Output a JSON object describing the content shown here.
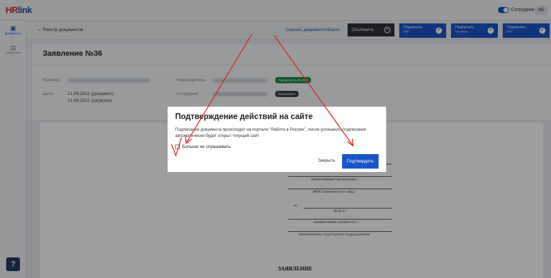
{
  "header": {
    "logo_prefix": "HR",
    "logo_suffix": "link",
    "role_label": "Сотрудник",
    "avatar_initials": "ВЕ"
  },
  "sidebar": {
    "items": [
      {
        "label": "Документы",
        "icon": "documents-icon"
      },
      {
        "label": "Заявления",
        "icon": "file-icon"
      }
    ],
    "help_label": "?"
  },
  "toolbar": {
    "back_label": "← Реестр документов",
    "download_label": "Скачать документооборот",
    "reject_label": "Отклонить",
    "sign_buttons": [
      {
        "title": "Подписать",
        "subtitle": "SMS"
      },
      {
        "title": "Подписать",
        "subtitle": "Госуслуги"
      },
      {
        "title": "Подписать",
        "subtitle": "КЭП"
      }
    ]
  },
  "document": {
    "title": "Заявление №36",
    "fields": {
      "entity_label": "Юрлицо:",
      "date_label": "Дата:",
      "date_doc": "21.09.2021 (документ)",
      "date_upload": "21.09.2021 (загрузка)",
      "manager_label": "Руководитель:",
      "manager_badge": "Подписан 21.09.2021",
      "employee_label": "Сотрудник:",
      "employee_badge": "Просмотрен"
    },
    "body": {
      "org_caption": "/наименование Организации /",
      "fio_caption": "/ФИО должностного лица /",
      "from_label": "от",
      "fio_short_caption": "/Ф.И.О./",
      "position_caption": "/наименование должности /",
      "dept_caption": "/наименование структурного подразделения/",
      "heading": "ЗАЯВЛЕНИЕ"
    }
  },
  "modal": {
    "title": "Подтверждение действий на сайте",
    "text": "Подписание документа происходит на портале \"Работа в России\", после успешного подписания автоматически будет открыт текущий сайт",
    "checkbox_label": "Больше не спрашивать",
    "close_label": "Закрыть",
    "confirm_label": "Подтвердить"
  },
  "colors": {
    "primary": "#1a56c9",
    "dark_button": "#2f3338",
    "badge_signed": "#1f8a4c",
    "badge_viewed": "#3a3f45",
    "annotation": "#e01919"
  }
}
